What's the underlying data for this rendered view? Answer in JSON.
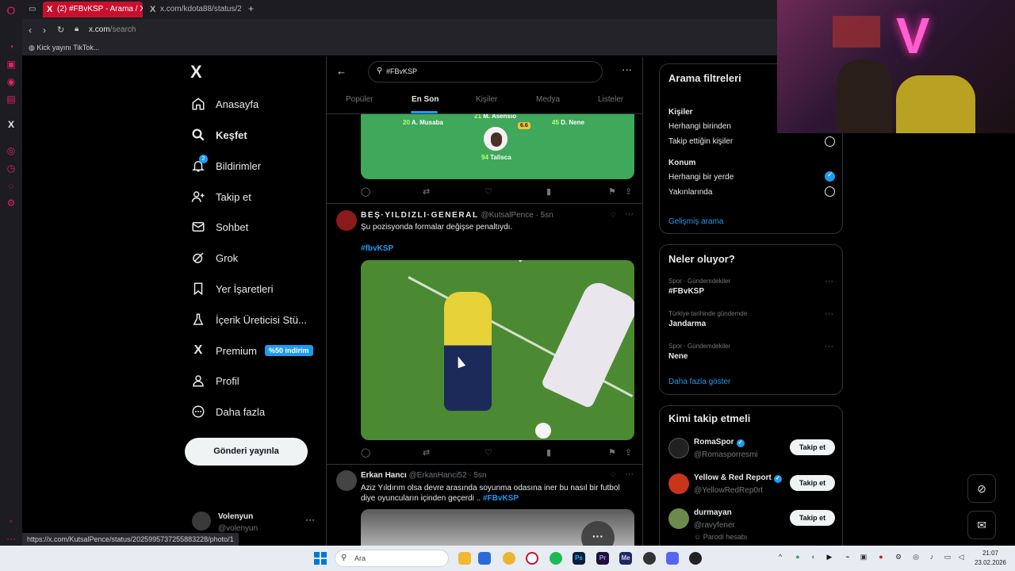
{
  "browser": {
    "tabs": [
      {
        "label": "(2) #FBvKSP - Arama / X",
        "active": true
      },
      {
        "label": "x.com/kdota88/status/202",
        "active": false
      }
    ],
    "new_tab": "+",
    "url_host": "x.com",
    "url_path": "/search",
    "bookmark": "Kick yayını TikTok..."
  },
  "nav": {
    "items": [
      {
        "label": "Anasayfa",
        "icon": "home-icon"
      },
      {
        "label": "Keşfet",
        "icon": "search-icon"
      },
      {
        "label": "Bildirimler",
        "icon": "bell-icon",
        "badge": "2"
      },
      {
        "label": "Takip et",
        "icon": "follow-icon"
      },
      {
        "label": "Sohbet",
        "icon": "mail-icon"
      },
      {
        "label": "Grok",
        "icon": "grok-icon"
      },
      {
        "label": "Yer İşaretleri",
        "icon": "bookmark-icon"
      },
      {
        "label": "İçerik Üreticisi Stü...",
        "icon": "creator-icon"
      },
      {
        "label": "Premium",
        "icon": "x-icon",
        "badge": "%50 indirim"
      },
      {
        "label": "Profil",
        "icon": "profile-icon"
      },
      {
        "label": "Daha fazla",
        "icon": "more-icon"
      }
    ],
    "post_button": "Gönderi yayınla",
    "profile": {
      "name": "Volenyun",
      "handle": "@volenyun",
      "more": "···"
    }
  },
  "status_url": "https://x.com/KutsalPence/status/2025995737255883228/photo/1",
  "search": {
    "query": "#FBvKSP",
    "tabs": [
      "Popüler",
      "En Son",
      "Kişiler",
      "Medya",
      "Listeler"
    ],
    "active_tab": "En Son"
  },
  "lineup": {
    "players": [
      {
        "num": "20",
        "name": "A. Musaba"
      },
      {
        "num": "21",
        "name": "M. Asensio"
      },
      {
        "num": "45",
        "name": "D. Nene"
      },
      {
        "num": "94",
        "name": "Talisca"
      }
    ],
    "rating": "6.6"
  },
  "tweets": [
    {
      "name": "BEŞ·YILDIZLI·GENERAL",
      "handle": "@KutsalPence",
      "time": "5sn",
      "text": "Şu pozisyonda formalar değişse penaltıydı.",
      "hashtag": "#fbvKSP"
    },
    {
      "name": "Erkan Hancı",
      "handle": "@ErkanHanci52",
      "time": "5sn",
      "text": "Aziz Yıldırım olsa devre arasında soyunma odasına iner bu nasıl bir futbol diye oyuncuların içinden geçerdi ..",
      "hashtag": "#FBvKSP"
    }
  ],
  "filters": {
    "title": "Arama filtreleri",
    "people_title": "Kişiler",
    "people_options": [
      "Herhangi birinden",
      "Takip ettiğin kişiler"
    ],
    "location_title": "Konum",
    "location_options": [
      "Herhangi bir yerde",
      "Yakınlarında"
    ],
    "advanced": "Gelişmiş arama"
  },
  "trends": {
    "title": "Neler oluyor?",
    "items": [
      {
        "category": "Spor · Gündemdekiler",
        "name": "#FBvKSP"
      },
      {
        "category": "Türkiye tarihinde gündemde",
        "name": "Jandarma"
      },
      {
        "category": "Spor · Gündemdekiler",
        "name": "Nene"
      }
    ],
    "show_more": "Daha fazla göster"
  },
  "who_to_follow": {
    "title": "Kimi takip etmeli",
    "accounts": [
      {
        "name": "RomaSpor",
        "handle": "@Romasporresmi",
        "verified": true,
        "button": "Takip et"
      },
      {
        "name": "Yellow & Red Report",
        "handle": "@YellowRedRep0rt",
        "verified": true,
        "button": "Takip et"
      },
      {
        "name": "durmayan",
        "handle": "@ravyfener",
        "verified": false,
        "sub": "Parodi hesabı",
        "button": "Takip et"
      }
    ]
  },
  "taskbar": {
    "search_placeholder": "Ara",
    "time": "21:07",
    "date": "23.02.2026"
  },
  "colors": {
    "accent": "#1d9bf0",
    "opera_red": "#c8102e",
    "pitch_green": "#3fa85a"
  }
}
